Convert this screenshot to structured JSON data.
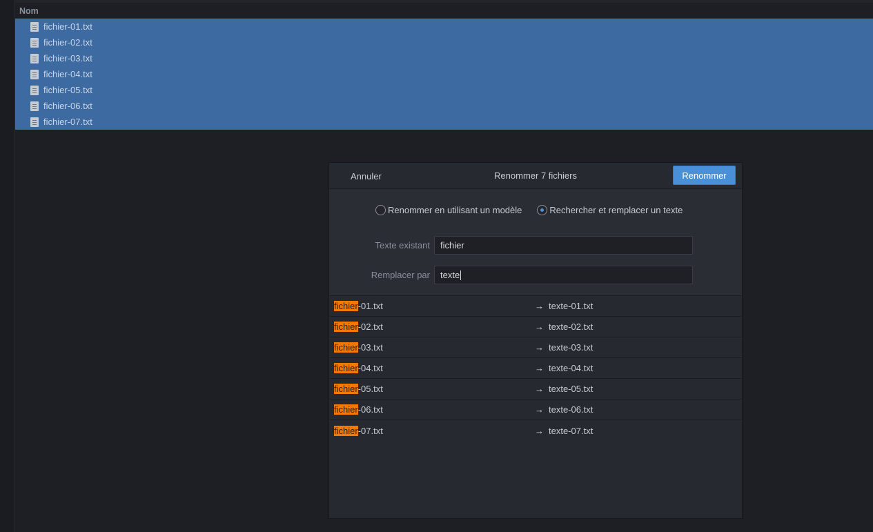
{
  "column_header": {
    "name_label": "Nom"
  },
  "files": [
    "fichier-01.txt",
    "fichier-02.txt",
    "fichier-03.txt",
    "fichier-04.txt",
    "fichier-05.txt",
    "fichier-06.txt",
    "fichier-07.txt"
  ],
  "dialog": {
    "cancel_label": "Annuler",
    "title": "Renommer 7 fichiers",
    "rename_label": "Renommer",
    "mode_template_label": "Renommer en utilisant un modèle",
    "mode_replace_label": "Rechercher et remplacer un texte",
    "mode_selected": "replace",
    "existing_label": "Texte existant",
    "existing_value": "fichier",
    "replace_label": "Remplacer par",
    "replace_value": "texte",
    "accent_color": "#4a90d9",
    "highlight_color": "#f57900"
  },
  "preview": [
    {
      "match": "fichier",
      "rest": "-01.txt",
      "arrow": "→",
      "new_name": "texte-01.txt"
    },
    {
      "match": "fichier",
      "rest": "-02.txt",
      "arrow": "→",
      "new_name": "texte-02.txt"
    },
    {
      "match": "fichier",
      "rest": "-03.txt",
      "arrow": "→",
      "new_name": "texte-03.txt"
    },
    {
      "match": "fichier",
      "rest": "-04.txt",
      "arrow": "→",
      "new_name": "texte-04.txt"
    },
    {
      "match": "fichier",
      "rest": "-05.txt",
      "arrow": "→",
      "new_name": "texte-05.txt"
    },
    {
      "match": "fichier",
      "rest": "-06.txt",
      "arrow": "→",
      "new_name": "texte-06.txt"
    },
    {
      "match": "fichier",
      "rest": "-07.txt",
      "arrow": "→",
      "new_name": "texte-07.txt"
    }
  ]
}
